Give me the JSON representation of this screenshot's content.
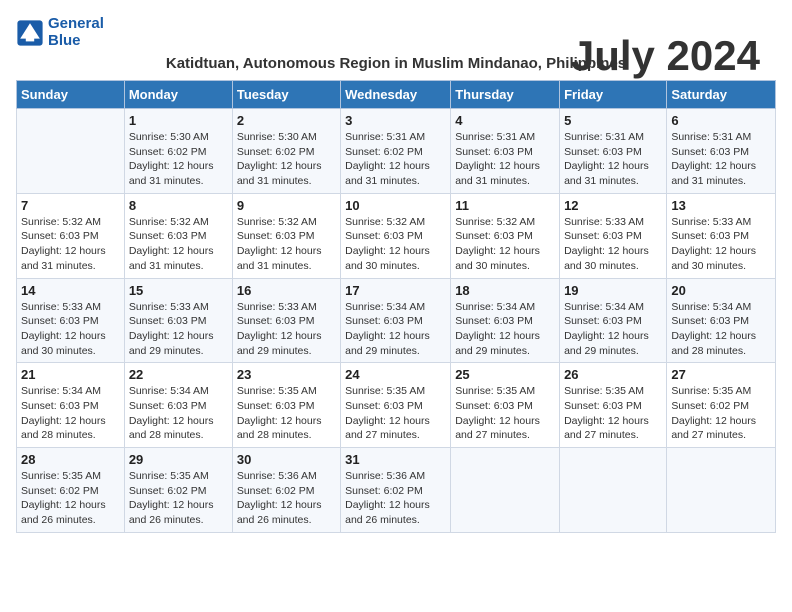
{
  "logo": {
    "name_line1": "General",
    "name_line2": "Blue"
  },
  "title": {
    "month_year": "July 2024",
    "location": "Katidtuan, Autonomous Region in Muslim Mindanao, Philippines"
  },
  "headers": [
    "Sunday",
    "Monday",
    "Tuesday",
    "Wednesday",
    "Thursday",
    "Friday",
    "Saturday"
  ],
  "weeks": [
    [
      {
        "day": "",
        "info": ""
      },
      {
        "day": "1",
        "info": "Sunrise: 5:30 AM\nSunset: 6:02 PM\nDaylight: 12 hours\nand 31 minutes."
      },
      {
        "day": "2",
        "info": "Sunrise: 5:30 AM\nSunset: 6:02 PM\nDaylight: 12 hours\nand 31 minutes."
      },
      {
        "day": "3",
        "info": "Sunrise: 5:31 AM\nSunset: 6:02 PM\nDaylight: 12 hours\nand 31 minutes."
      },
      {
        "day": "4",
        "info": "Sunrise: 5:31 AM\nSunset: 6:03 PM\nDaylight: 12 hours\nand 31 minutes."
      },
      {
        "day": "5",
        "info": "Sunrise: 5:31 AM\nSunset: 6:03 PM\nDaylight: 12 hours\nand 31 minutes."
      },
      {
        "day": "6",
        "info": "Sunrise: 5:31 AM\nSunset: 6:03 PM\nDaylight: 12 hours\nand 31 minutes."
      }
    ],
    [
      {
        "day": "7",
        "info": "Sunrise: 5:32 AM\nSunset: 6:03 PM\nDaylight: 12 hours\nand 31 minutes."
      },
      {
        "day": "8",
        "info": "Sunrise: 5:32 AM\nSunset: 6:03 PM\nDaylight: 12 hours\nand 31 minutes."
      },
      {
        "day": "9",
        "info": "Sunrise: 5:32 AM\nSunset: 6:03 PM\nDaylight: 12 hours\nand 31 minutes."
      },
      {
        "day": "10",
        "info": "Sunrise: 5:32 AM\nSunset: 6:03 PM\nDaylight: 12 hours\nand 30 minutes."
      },
      {
        "day": "11",
        "info": "Sunrise: 5:32 AM\nSunset: 6:03 PM\nDaylight: 12 hours\nand 30 minutes."
      },
      {
        "day": "12",
        "info": "Sunrise: 5:33 AM\nSunset: 6:03 PM\nDaylight: 12 hours\nand 30 minutes."
      },
      {
        "day": "13",
        "info": "Sunrise: 5:33 AM\nSunset: 6:03 PM\nDaylight: 12 hours\nand 30 minutes."
      }
    ],
    [
      {
        "day": "14",
        "info": "Sunrise: 5:33 AM\nSunset: 6:03 PM\nDaylight: 12 hours\nand 30 minutes."
      },
      {
        "day": "15",
        "info": "Sunrise: 5:33 AM\nSunset: 6:03 PM\nDaylight: 12 hours\nand 29 minutes."
      },
      {
        "day": "16",
        "info": "Sunrise: 5:33 AM\nSunset: 6:03 PM\nDaylight: 12 hours\nand 29 minutes."
      },
      {
        "day": "17",
        "info": "Sunrise: 5:34 AM\nSunset: 6:03 PM\nDaylight: 12 hours\nand 29 minutes."
      },
      {
        "day": "18",
        "info": "Sunrise: 5:34 AM\nSunset: 6:03 PM\nDaylight: 12 hours\nand 29 minutes."
      },
      {
        "day": "19",
        "info": "Sunrise: 5:34 AM\nSunset: 6:03 PM\nDaylight: 12 hours\nand 29 minutes."
      },
      {
        "day": "20",
        "info": "Sunrise: 5:34 AM\nSunset: 6:03 PM\nDaylight: 12 hours\nand 28 minutes."
      }
    ],
    [
      {
        "day": "21",
        "info": "Sunrise: 5:34 AM\nSunset: 6:03 PM\nDaylight: 12 hours\nand 28 minutes."
      },
      {
        "day": "22",
        "info": "Sunrise: 5:34 AM\nSunset: 6:03 PM\nDaylight: 12 hours\nand 28 minutes."
      },
      {
        "day": "23",
        "info": "Sunrise: 5:35 AM\nSunset: 6:03 PM\nDaylight: 12 hours\nand 28 minutes."
      },
      {
        "day": "24",
        "info": "Sunrise: 5:35 AM\nSunset: 6:03 PM\nDaylight: 12 hours\nand 27 minutes."
      },
      {
        "day": "25",
        "info": "Sunrise: 5:35 AM\nSunset: 6:03 PM\nDaylight: 12 hours\nand 27 minutes."
      },
      {
        "day": "26",
        "info": "Sunrise: 5:35 AM\nSunset: 6:03 PM\nDaylight: 12 hours\nand 27 minutes."
      },
      {
        "day": "27",
        "info": "Sunrise: 5:35 AM\nSunset: 6:02 PM\nDaylight: 12 hours\nand 27 minutes."
      }
    ],
    [
      {
        "day": "28",
        "info": "Sunrise: 5:35 AM\nSunset: 6:02 PM\nDaylight: 12 hours\nand 26 minutes."
      },
      {
        "day": "29",
        "info": "Sunrise: 5:35 AM\nSunset: 6:02 PM\nDaylight: 12 hours\nand 26 minutes."
      },
      {
        "day": "30",
        "info": "Sunrise: 5:36 AM\nSunset: 6:02 PM\nDaylight: 12 hours\nand 26 minutes."
      },
      {
        "day": "31",
        "info": "Sunrise: 5:36 AM\nSunset: 6:02 PM\nDaylight: 12 hours\nand 26 minutes."
      },
      {
        "day": "",
        "info": ""
      },
      {
        "day": "",
        "info": ""
      },
      {
        "day": "",
        "info": ""
      }
    ]
  ]
}
